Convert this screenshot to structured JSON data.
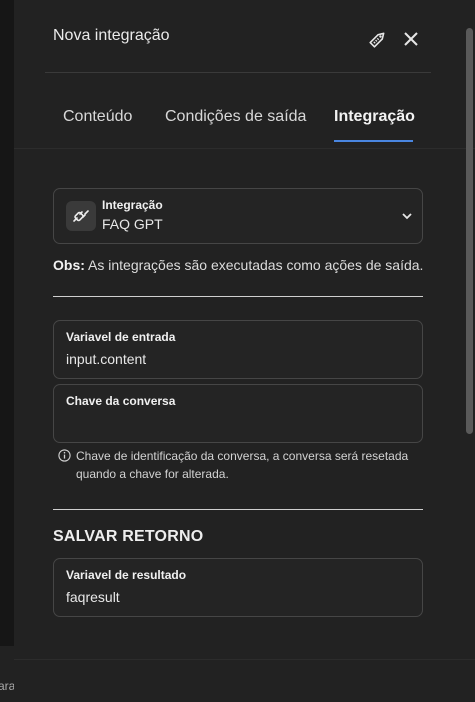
{
  "header": {
    "title": "Nova integração",
    "tag_icon": "tag-icon",
    "close_icon": "close-icon"
  },
  "tabs": [
    {
      "label": "Conteúdo",
      "active": false
    },
    {
      "label": "Condições de saída",
      "active": false
    },
    {
      "label": "Integração",
      "active": true
    }
  ],
  "integration": {
    "label": "Integração",
    "value": "FAQ GPT",
    "icon": "plug-icon"
  },
  "obs": {
    "prefix": "Obs:",
    "text": "As integrações são executadas como ações de saída."
  },
  "input_variable": {
    "label": "Variavel de entrada",
    "value": "input.content"
  },
  "conversation_key": {
    "label": "Chave da conversa",
    "value": "",
    "hint": "Chave de identificação da conversa, a conversa será resetada quando a chave for alterada."
  },
  "save_section": {
    "title": "SALVAR RETORNO"
  },
  "result_variable": {
    "label": "Variavel de resultado",
    "value": "faqresult"
  },
  "background": {
    "partial_text": "ara"
  },
  "colors": {
    "panel_bg": "#222222",
    "accent": "#4a86e0"
  }
}
